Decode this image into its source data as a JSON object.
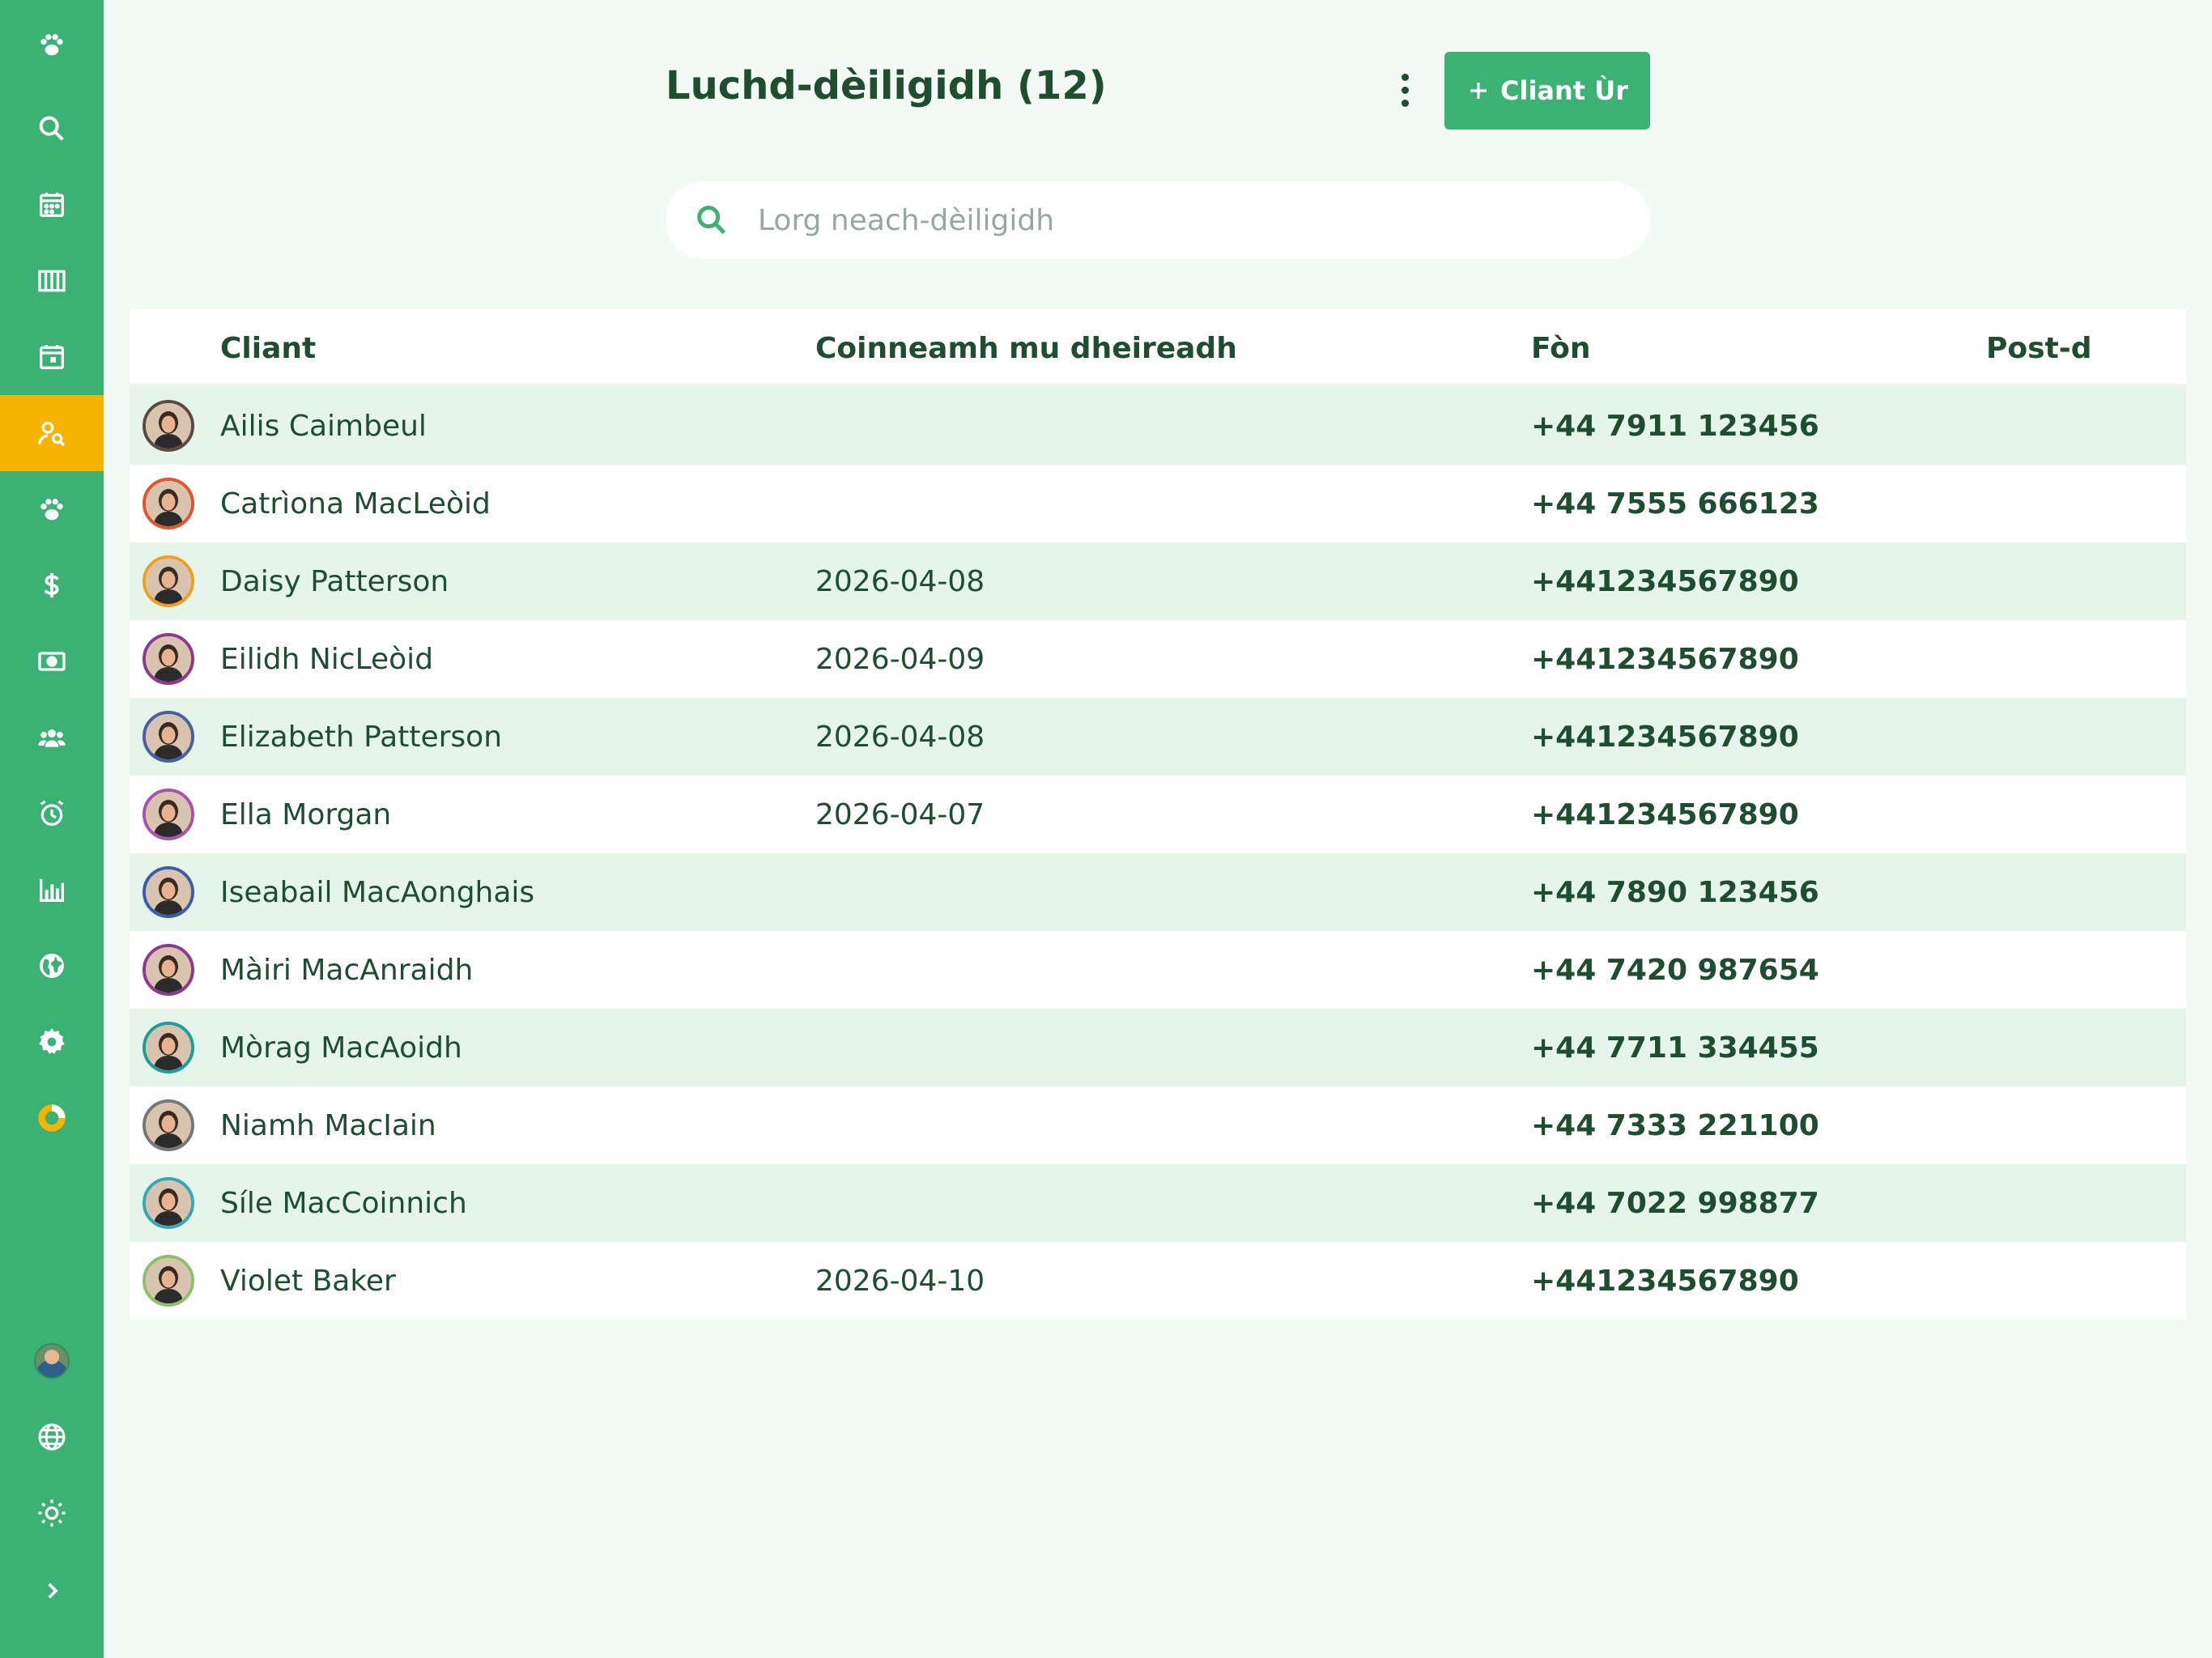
{
  "page": {
    "title": "Luchd-dèiligidh (12)",
    "new_button_label": "Cliant Ùr",
    "search_placeholder": "Lorg neach-dèiligidh"
  },
  "colors": {
    "sidebar": "#3bb273",
    "active": "#f6b400",
    "text": "#1e4d2f",
    "row_alt": "#e6f5ea",
    "background": "#f3f9f5"
  },
  "sidebar": {
    "items": [
      {
        "icon": "paw-icon"
      },
      {
        "icon": "search-icon"
      },
      {
        "icon": "calendar-icon"
      },
      {
        "icon": "columns-icon"
      },
      {
        "icon": "calendar-day-icon"
      },
      {
        "icon": "client-search-icon",
        "active": true
      },
      {
        "icon": "paw-icon"
      },
      {
        "icon": "dollar-icon"
      },
      {
        "icon": "cash-icon"
      },
      {
        "icon": "team-icon"
      },
      {
        "icon": "alarm-icon"
      },
      {
        "icon": "bar-chart-icon"
      },
      {
        "icon": "globe-filled-icon"
      },
      {
        "icon": "gear-icon"
      },
      {
        "icon": "donut-icon"
      }
    ],
    "bottom": [
      {
        "icon": "user-avatar"
      },
      {
        "icon": "globe-icon"
      },
      {
        "icon": "sun-icon"
      },
      {
        "icon": "chevron-right-icon"
      }
    ]
  },
  "table": {
    "headers": {
      "client": "Cliant",
      "last_appointment": "Coinneamh mu dheireadh",
      "phone": "Fòn",
      "email": "Post-d"
    },
    "rows": [
      {
        "name": "Ailis Caimbeul",
        "last": "",
        "phone": "+44 7911 123456",
        "email": "",
        "ring": "#5b4a3f"
      },
      {
        "name": "Catrìona MacLeòid",
        "last": "",
        "phone": "+44 7555 666123",
        "email": "",
        "ring": "#e0552b"
      },
      {
        "name": "Daisy Patterson",
        "last": "2026-04-08",
        "phone": "+441234567890",
        "email": "",
        "ring": "#f0a020"
      },
      {
        "name": "Eilidh NicLeòid",
        "last": "2026-04-09",
        "phone": "+441234567890",
        "email": "",
        "ring": "#8b3a8f"
      },
      {
        "name": "Elizabeth Patterson",
        "last": "2026-04-08",
        "phone": "+441234567890",
        "email": "",
        "ring": "#4a5fa0"
      },
      {
        "name": "Ella Morgan",
        "last": "2026-04-07",
        "phone": "+441234567890",
        "email": "",
        "ring": "#a552b0"
      },
      {
        "name": "Iseabail MacAonghais",
        "last": "",
        "phone": "+44 7890 123456",
        "email": "",
        "ring": "#3d5ea6"
      },
      {
        "name": "Màiri MacAnraidh",
        "last": "",
        "phone": "+44 7420 987654",
        "email": "",
        "ring": "#8b3a8f"
      },
      {
        "name": "Mòrag MacAoidh",
        "last": "",
        "phone": "+44 7711 334455",
        "email": "",
        "ring": "#1f9d9d"
      },
      {
        "name": "Niamh MacIain",
        "last": "",
        "phone": "+44 7333 221100",
        "email": "",
        "ring": "#777777"
      },
      {
        "name": "Síle MacCoinnich",
        "last": "",
        "phone": "+44 7022 998877",
        "email": "",
        "ring": "#35a7b5"
      },
      {
        "name": "Violet Baker",
        "last": "2026-04-10",
        "phone": "+441234567890",
        "email": "",
        "ring": "#8fbf6a"
      }
    ]
  }
}
